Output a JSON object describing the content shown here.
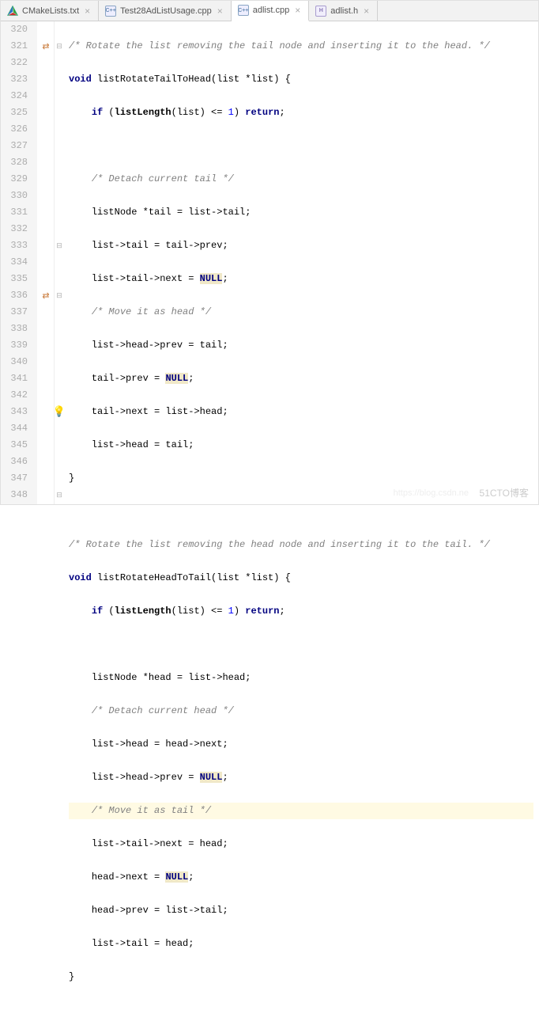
{
  "tabs": [
    {
      "label": "CMakeLists.txt",
      "icon": "cmake-icon",
      "active": false
    },
    {
      "label": "Test28AdListUsage.cpp",
      "icon": "cpp-icon",
      "active": false
    },
    {
      "label": "adlist.cpp",
      "icon": "cpp-icon",
      "active": true
    },
    {
      "label": "adlist.h",
      "icon": "h-icon",
      "active": false
    }
  ],
  "lines": {
    "n320": "320",
    "n321": "321",
    "n322": "322",
    "n323": "323",
    "n324": "324",
    "n325": "325",
    "n326": "326",
    "n327": "327",
    "n328": "328",
    "n329": "329",
    "n330": "330",
    "n331": "331",
    "n332": "332",
    "n333": "333",
    "n334": "334",
    "n335": "335",
    "n336": "336",
    "n337": "337",
    "n338": "338",
    "n339": "339",
    "n340": "340",
    "n341": "341",
    "n342": "342",
    "n343": "343",
    "n344": "344",
    "n345": "345",
    "n346": "346",
    "n347": "347",
    "n348": "348"
  },
  "code": {
    "l320": "/* Rotate the list removing the tail node and inserting it to the head. */",
    "l321a": "void",
    "l321b": " listRotateTailToHead(list *list) {",
    "l322a": "if",
    "l322b": " (",
    "l322c": "listLength",
    "l322d": "(list) <= ",
    "l322e": "1",
    "l322f": ") ",
    "l322g": "return",
    "l322h": ";",
    "l324": "/* Detach current tail */",
    "l325": "listNode *tail = list->tail;",
    "l326": "list->tail = tail->prev;",
    "l327a": "list->tail->next = ",
    "l327b": "NULL",
    "l327c": ";",
    "l328": "/* Move it as head */",
    "l329": "list->head->prev = tail;",
    "l330a": "tail->prev = ",
    "l330b": "NULL",
    "l330c": ";",
    "l331": "tail->next = list->head;",
    "l332": "list->head = tail;",
    "l333": "}",
    "l335": "/* Rotate the list removing the head node and inserting it to the tail. */",
    "l336a": "void",
    "l336b": " listRotateHeadToTail(list *list) {",
    "l337a": "if",
    "l337b": " (",
    "l337c": "listLength",
    "l337d": "(list) <= ",
    "l337e": "1",
    "l337f": ") ",
    "l337g": "return",
    "l337h": ";",
    "l339": "listNode *head = list->head;",
    "l340": "/* Detach current head */",
    "l341": "list->head = head->next;",
    "l342a": "list->head->prev = ",
    "l342b": "NULL",
    "l342c": ";",
    "l343": "/* Move it as tail */",
    "l344": "list->tail->next = head;",
    "l345a": "head->next = ",
    "l345b": "NULL",
    "l345c": ";",
    "l346": "head->prev = list->tail;",
    "l347": "list->tail = head;",
    "l348": "}"
  },
  "watermark_main": "51CTO博客",
  "watermark_sub": "https://blog.csdn.ne"
}
